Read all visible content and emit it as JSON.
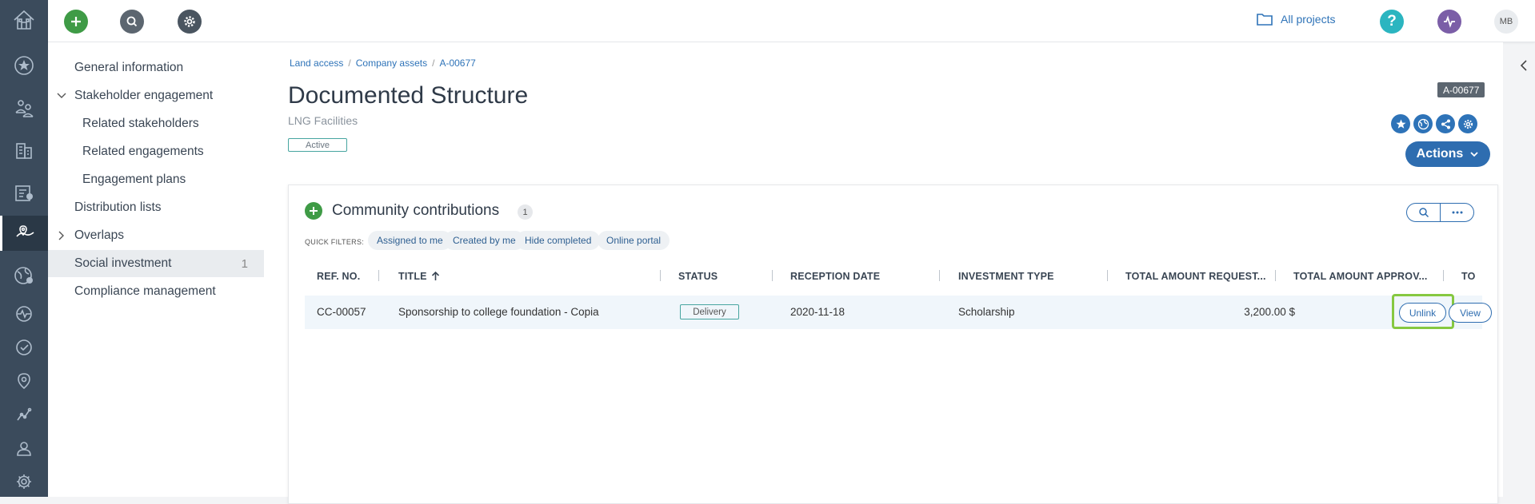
{
  "topbar": {
    "all_projects": "All projects",
    "avatar_initials": "MB",
    "icons": [
      "add-icon",
      "search-icon",
      "gear-icon",
      "help-icon",
      "activity-icon"
    ]
  },
  "rail": {
    "items": [
      "home-icon",
      "star-icon",
      "stakeholders-icon",
      "buildings-icon",
      "checklist-icon",
      "land-access-icon",
      "globe-icon",
      "pulse-icon",
      "check-circle-icon",
      "location-icon",
      "chart-icon",
      "user-icon",
      "settings-icon"
    ]
  },
  "sidenav": {
    "items": [
      {
        "label": "General information"
      },
      {
        "label": "Stakeholder engagement"
      },
      {
        "label": "Related stakeholders"
      },
      {
        "label": "Related engagements"
      },
      {
        "label": "Engagement plans"
      },
      {
        "label": "Distribution lists"
      },
      {
        "label": "Overlaps"
      },
      {
        "label": "Social investment",
        "count": "1"
      },
      {
        "label": "Compliance management"
      }
    ]
  },
  "breadcrumb": [
    "Land access",
    "Company assets",
    "A-00677"
  ],
  "page": {
    "title": "Documented Structure",
    "subtitle": "LNG Facilities",
    "status": "Active",
    "ref": "A-00677",
    "actions_label": "Actions"
  },
  "card": {
    "title": "Community contributions",
    "count": "1",
    "quick_filters_label": "QUICK FILTERS:",
    "quick_filters": [
      "Assigned to me",
      "Created by me",
      "Hide completed",
      "Online portal"
    ],
    "columns": [
      "REF. NO.",
      "TITLE",
      "STATUS",
      "RECEPTION DATE",
      "INVESTMENT TYPE",
      "TOTAL AMOUNT REQUEST...",
      "TOTAL AMOUNT APPROV...",
      "TO"
    ],
    "rows": [
      {
        "ref": "CC-00057",
        "title": "Sponsorship to college foundation - Copia",
        "status": "Delivery",
        "reception_date": "2020-11-18",
        "investment_type": "Scholarship",
        "amount_requested": "3,200.00 $",
        "unlink_label": "Unlink",
        "view_label": "View"
      }
    ]
  },
  "colors": {
    "rail": "#3b4b5c",
    "accent": "#2e6db0",
    "green": "#3f9b46",
    "highlight": "#86c840"
  }
}
